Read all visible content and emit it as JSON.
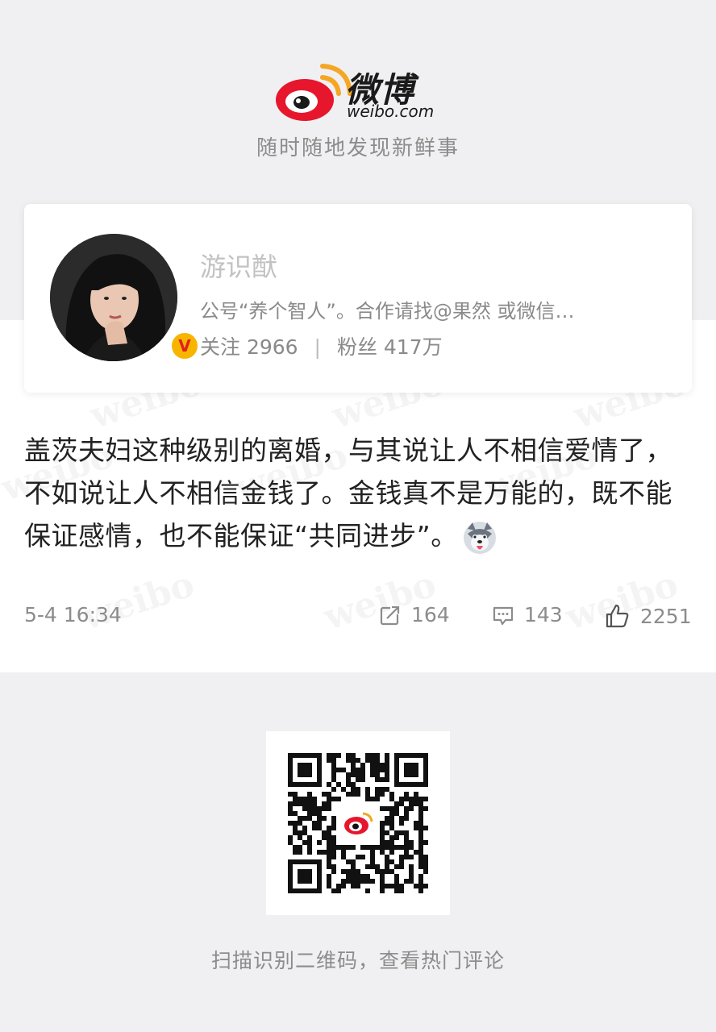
{
  "brand": {
    "name": "微博",
    "domain": "weibo.com",
    "tagline": "随时随地发现新鲜事",
    "logo_icon": "weibo-eye-logo",
    "accent_color": "#e6162d"
  },
  "profile": {
    "name": "游识猷",
    "bio": "公号“养个智人”。合作请找@果然 或微信…",
    "following_label": "关注",
    "following_count": "2966",
    "separator": "|",
    "followers_label": "粉丝",
    "followers_count": "417万",
    "verified_badge": "V"
  },
  "post": {
    "text": "盖茨夫妇这种级别的离婚，与其说让人不相信爱情了，不如说让人不相信金钱了。金钱真不是万能的，既不能保证感情，也不能保证“共同进步”。",
    "emoji": "husky-emoji",
    "time": "5-4 16:34",
    "reposts": "164",
    "comments": "143",
    "likes": "2251"
  },
  "footer": {
    "qr_caption": "扫描识别二维码，查看热门评论"
  }
}
